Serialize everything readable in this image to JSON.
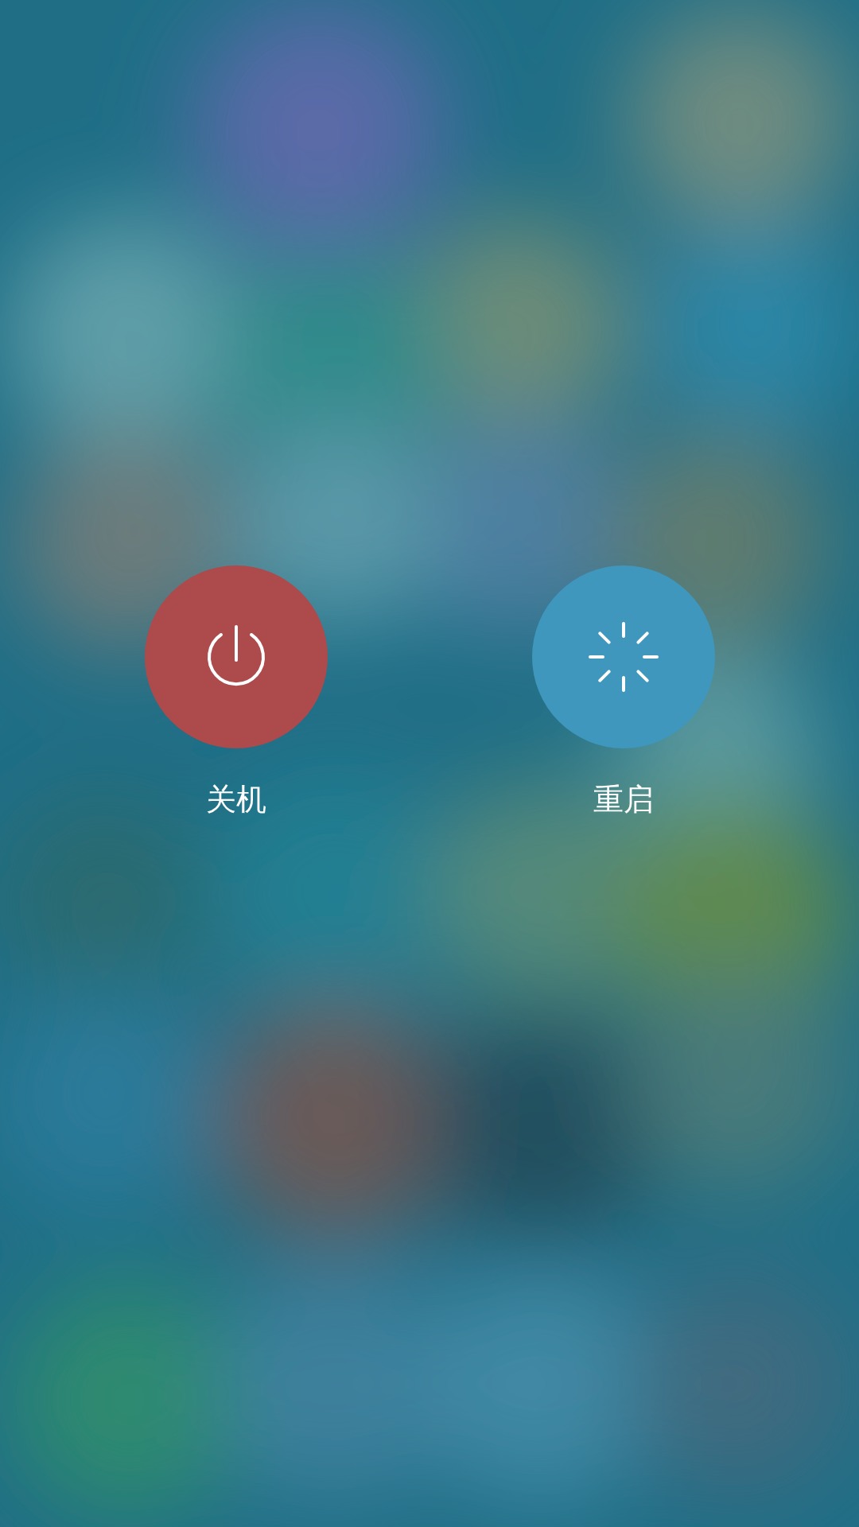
{
  "buttons": [
    {
      "kind": "power",
      "label": "关机"
    },
    {
      "kind": "restart",
      "label": "重启"
    }
  ]
}
